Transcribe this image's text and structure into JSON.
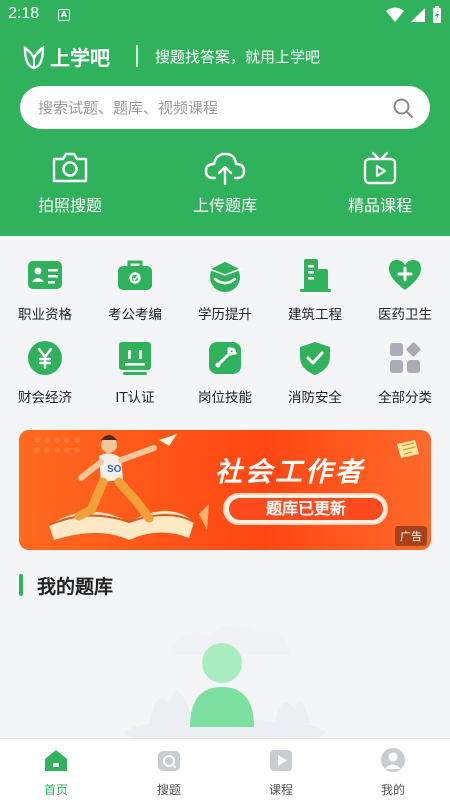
{
  "status_bar": {
    "time": "2:18",
    "notification_badge": "A"
  },
  "header": {
    "brand_name": "上学吧",
    "slogan": "搜题找答案，就用上学吧",
    "search_placeholder": "搜索试题、题库、视频课程",
    "quick_actions": [
      {
        "label": "拍照搜题",
        "icon": "camera-icon"
      },
      {
        "label": "上传题库",
        "icon": "cloud-upload-icon"
      },
      {
        "label": "精品课程",
        "icon": "tv-play-icon"
      }
    ]
  },
  "categories": [
    {
      "label": "职业资格",
      "icon": "id-card-icon"
    },
    {
      "label": "考公考编",
      "icon": "briefcase-icon"
    },
    {
      "label": "学历提升",
      "icon": "graduation-cap-icon"
    },
    {
      "label": "建筑工程",
      "icon": "building-icon"
    },
    {
      "label": "医药卫生",
      "icon": "medical-heart-icon"
    },
    {
      "label": "财会经济",
      "icon": "yen-coin-icon"
    },
    {
      "label": "IT认证",
      "icon": "monitor-icon"
    },
    {
      "label": "岗位技能",
      "icon": "wrench-icon"
    },
    {
      "label": "消防安全",
      "icon": "shield-check-icon"
    },
    {
      "label": "全部分类",
      "icon": "grid-diamond-icon"
    }
  ],
  "banner": {
    "title": "社会工作者",
    "subtitle": "题库已更新",
    "ad_tag": "广告",
    "shirt_text": "SO"
  },
  "section": {
    "title": "我的题库"
  },
  "tabs": [
    {
      "label": "首页",
      "icon": "home-icon",
      "active": true
    },
    {
      "label": "搜题",
      "icon": "search-camera-icon",
      "active": false
    },
    {
      "label": "课程",
      "icon": "video-icon",
      "active": false
    },
    {
      "label": "我的",
      "icon": "user-icon",
      "active": false
    }
  ],
  "colors": {
    "brand_green": "#2fb25b",
    "banner_orange": "#ff4a1e",
    "tab_inactive": "#c9ccd1"
  }
}
